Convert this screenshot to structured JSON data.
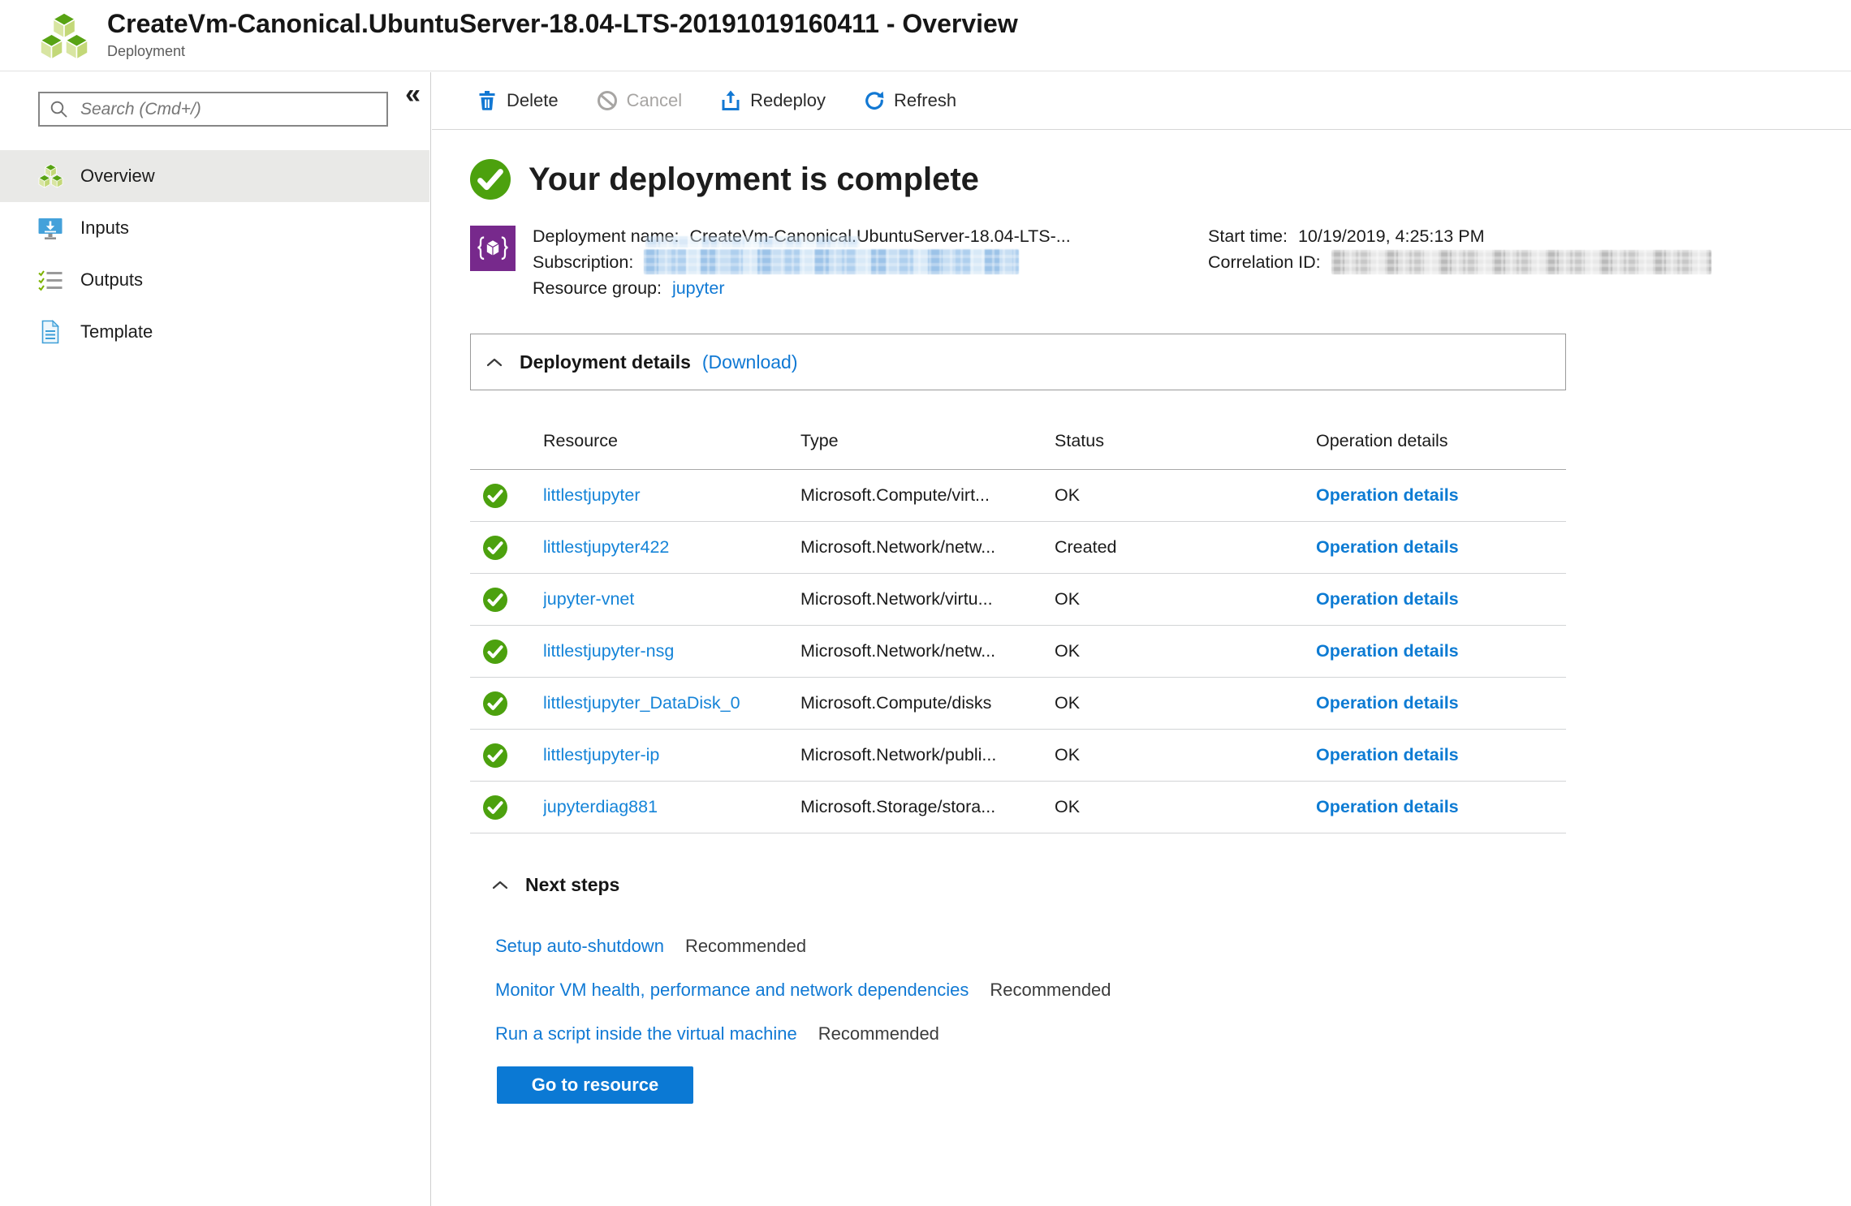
{
  "header": {
    "title": "CreateVm-Canonical.UbuntuServer-18.04-LTS-20191019160411 - Overview",
    "subtitle": "Deployment"
  },
  "sidebar": {
    "collapse_glyph": "«",
    "search_placeholder": "Search (Cmd+/)",
    "items": [
      {
        "label": "Overview",
        "icon": "deployment-cubes-icon",
        "selected": true
      },
      {
        "label": "Inputs",
        "icon": "inputs-monitor-icon",
        "selected": false
      },
      {
        "label": "Outputs",
        "icon": "outputs-checklist-icon",
        "selected": false
      },
      {
        "label": "Template",
        "icon": "template-document-icon",
        "selected": false
      }
    ]
  },
  "toolbar": {
    "buttons": [
      {
        "label": "Delete",
        "icon": "trash-icon",
        "enabled": true
      },
      {
        "label": "Cancel",
        "icon": "cancel-icon",
        "enabled": false
      },
      {
        "label": "Redeploy",
        "icon": "redeploy-icon",
        "enabled": true
      },
      {
        "label": "Refresh",
        "icon": "refresh-icon",
        "enabled": true
      }
    ]
  },
  "main": {
    "status_heading": "Your deployment is complete",
    "info": {
      "deployment_name_label": "Deployment name:",
      "deployment_name": "CreateVm-Canonical.UbuntuServer-18.04-LTS-...",
      "subscription_label": "Subscription:",
      "subscription_redacted": true,
      "resource_group_label": "Resource group:",
      "resource_group": "jupyter",
      "start_time_label": "Start time:",
      "start_time": "10/19/2019, 4:25:13 PM",
      "correlation_id_label": "Correlation ID:",
      "correlation_id_redacted": true
    },
    "deployment_details": {
      "title": "Deployment details",
      "download_label": "(Download)"
    },
    "table": {
      "headers": [
        "Resource",
        "Type",
        "Status",
        "Operation details"
      ],
      "row_status_icon": "success-check-icon",
      "rows": [
        {
          "resource": "littlestjupyter",
          "type": "Microsoft.Compute/virt...",
          "status": "OK",
          "operation": "Operation details"
        },
        {
          "resource": "littlestjupyter422",
          "type": "Microsoft.Network/netw...",
          "status": "Created",
          "operation": "Operation details"
        },
        {
          "resource": "jupyter-vnet",
          "type": "Microsoft.Network/virtu...",
          "status": "OK",
          "operation": "Operation details"
        },
        {
          "resource": "littlestjupyter-nsg",
          "type": "Microsoft.Network/netw...",
          "status": "OK",
          "operation": "Operation details"
        },
        {
          "resource": "littlestjupyter_DataDisk_0",
          "type": "Microsoft.Compute/disks",
          "status": "OK",
          "operation": "Operation details"
        },
        {
          "resource": "littlestjupyter-ip",
          "type": "Microsoft.Network/publi...",
          "status": "OK",
          "operation": "Operation details"
        },
        {
          "resource": "jupyterdiag881",
          "type": "Microsoft.Storage/stora...",
          "status": "OK",
          "operation": "Operation details"
        }
      ]
    },
    "next_steps": {
      "title": "Next steps",
      "links": [
        {
          "label": "Setup auto-shutdown",
          "badge": "Recommended"
        },
        {
          "label": "Monitor VM health, performance and network dependencies",
          "badge": "Recommended"
        },
        {
          "label": "Run a script inside the virtual machine",
          "badge": "Recommended"
        }
      ],
      "button_label": "Go to resource"
    }
  },
  "colors": {
    "accent": "#0078d4",
    "link": "#1079d4",
    "resource_link": "#1584d8",
    "success_green": "#4ca10e",
    "arm_purple": "#77298c",
    "selected_item_bg": "#e9e9e7"
  }
}
